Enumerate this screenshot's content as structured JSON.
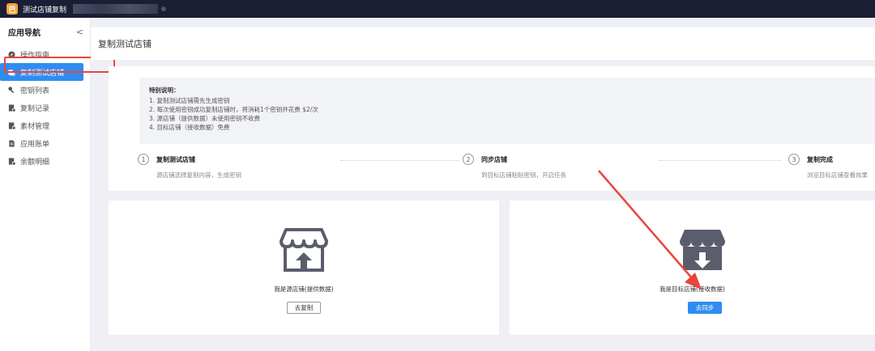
{
  "topbar": {
    "app_title": "测试店铺复制",
    "logo_glyph": "巴"
  },
  "sidebar": {
    "header": "应用导航",
    "collapse": "<",
    "items": [
      {
        "label": "操作指南",
        "icon": "compass-icon"
      },
      {
        "label": "复制测试店铺",
        "icon": "copy-store-icon",
        "active": true
      },
      {
        "label": "密钥列表",
        "icon": "key-icon"
      },
      {
        "label": "复制记录",
        "icon": "record-icon"
      },
      {
        "label": "素材管理",
        "icon": "material-icon"
      },
      {
        "label": "应用账单",
        "icon": "bill-icon"
      },
      {
        "label": "余额明细",
        "icon": "balance-icon"
      }
    ]
  },
  "page_title": "复制测试店铺",
  "notice": {
    "title": "特别说明：",
    "lines": [
      "1. 复制测试店铺需先生成密钥",
      "2. 每次使用密钥成功复制店铺时，将消耗1个密钥并花费 $2/次",
      "3. 源店铺（提供数据）未使用密钥不收费",
      "4. 目标店铺（接收数据）免费"
    ]
  },
  "steps": [
    {
      "num": "1",
      "title": "复制测试店铺",
      "desc": "源店铺选择复制内容，生成密钥"
    },
    {
      "num": "2",
      "title": "同步店铺",
      "desc": "到目标店铺粘贴密钥，开启任务"
    },
    {
      "num": "3",
      "title": "复制完成",
      "desc": "浏览目标店铺查看效果"
    }
  ],
  "cards": {
    "source": {
      "label": "我是源店铺(提供数据)",
      "button": "去复制"
    },
    "target": {
      "label": "我是目标店铺(接收数据)",
      "button": "去同步"
    }
  },
  "colors": {
    "accent": "#2f8cf0",
    "topbar": "#1a1f36",
    "annotation": "#e8463c"
  }
}
